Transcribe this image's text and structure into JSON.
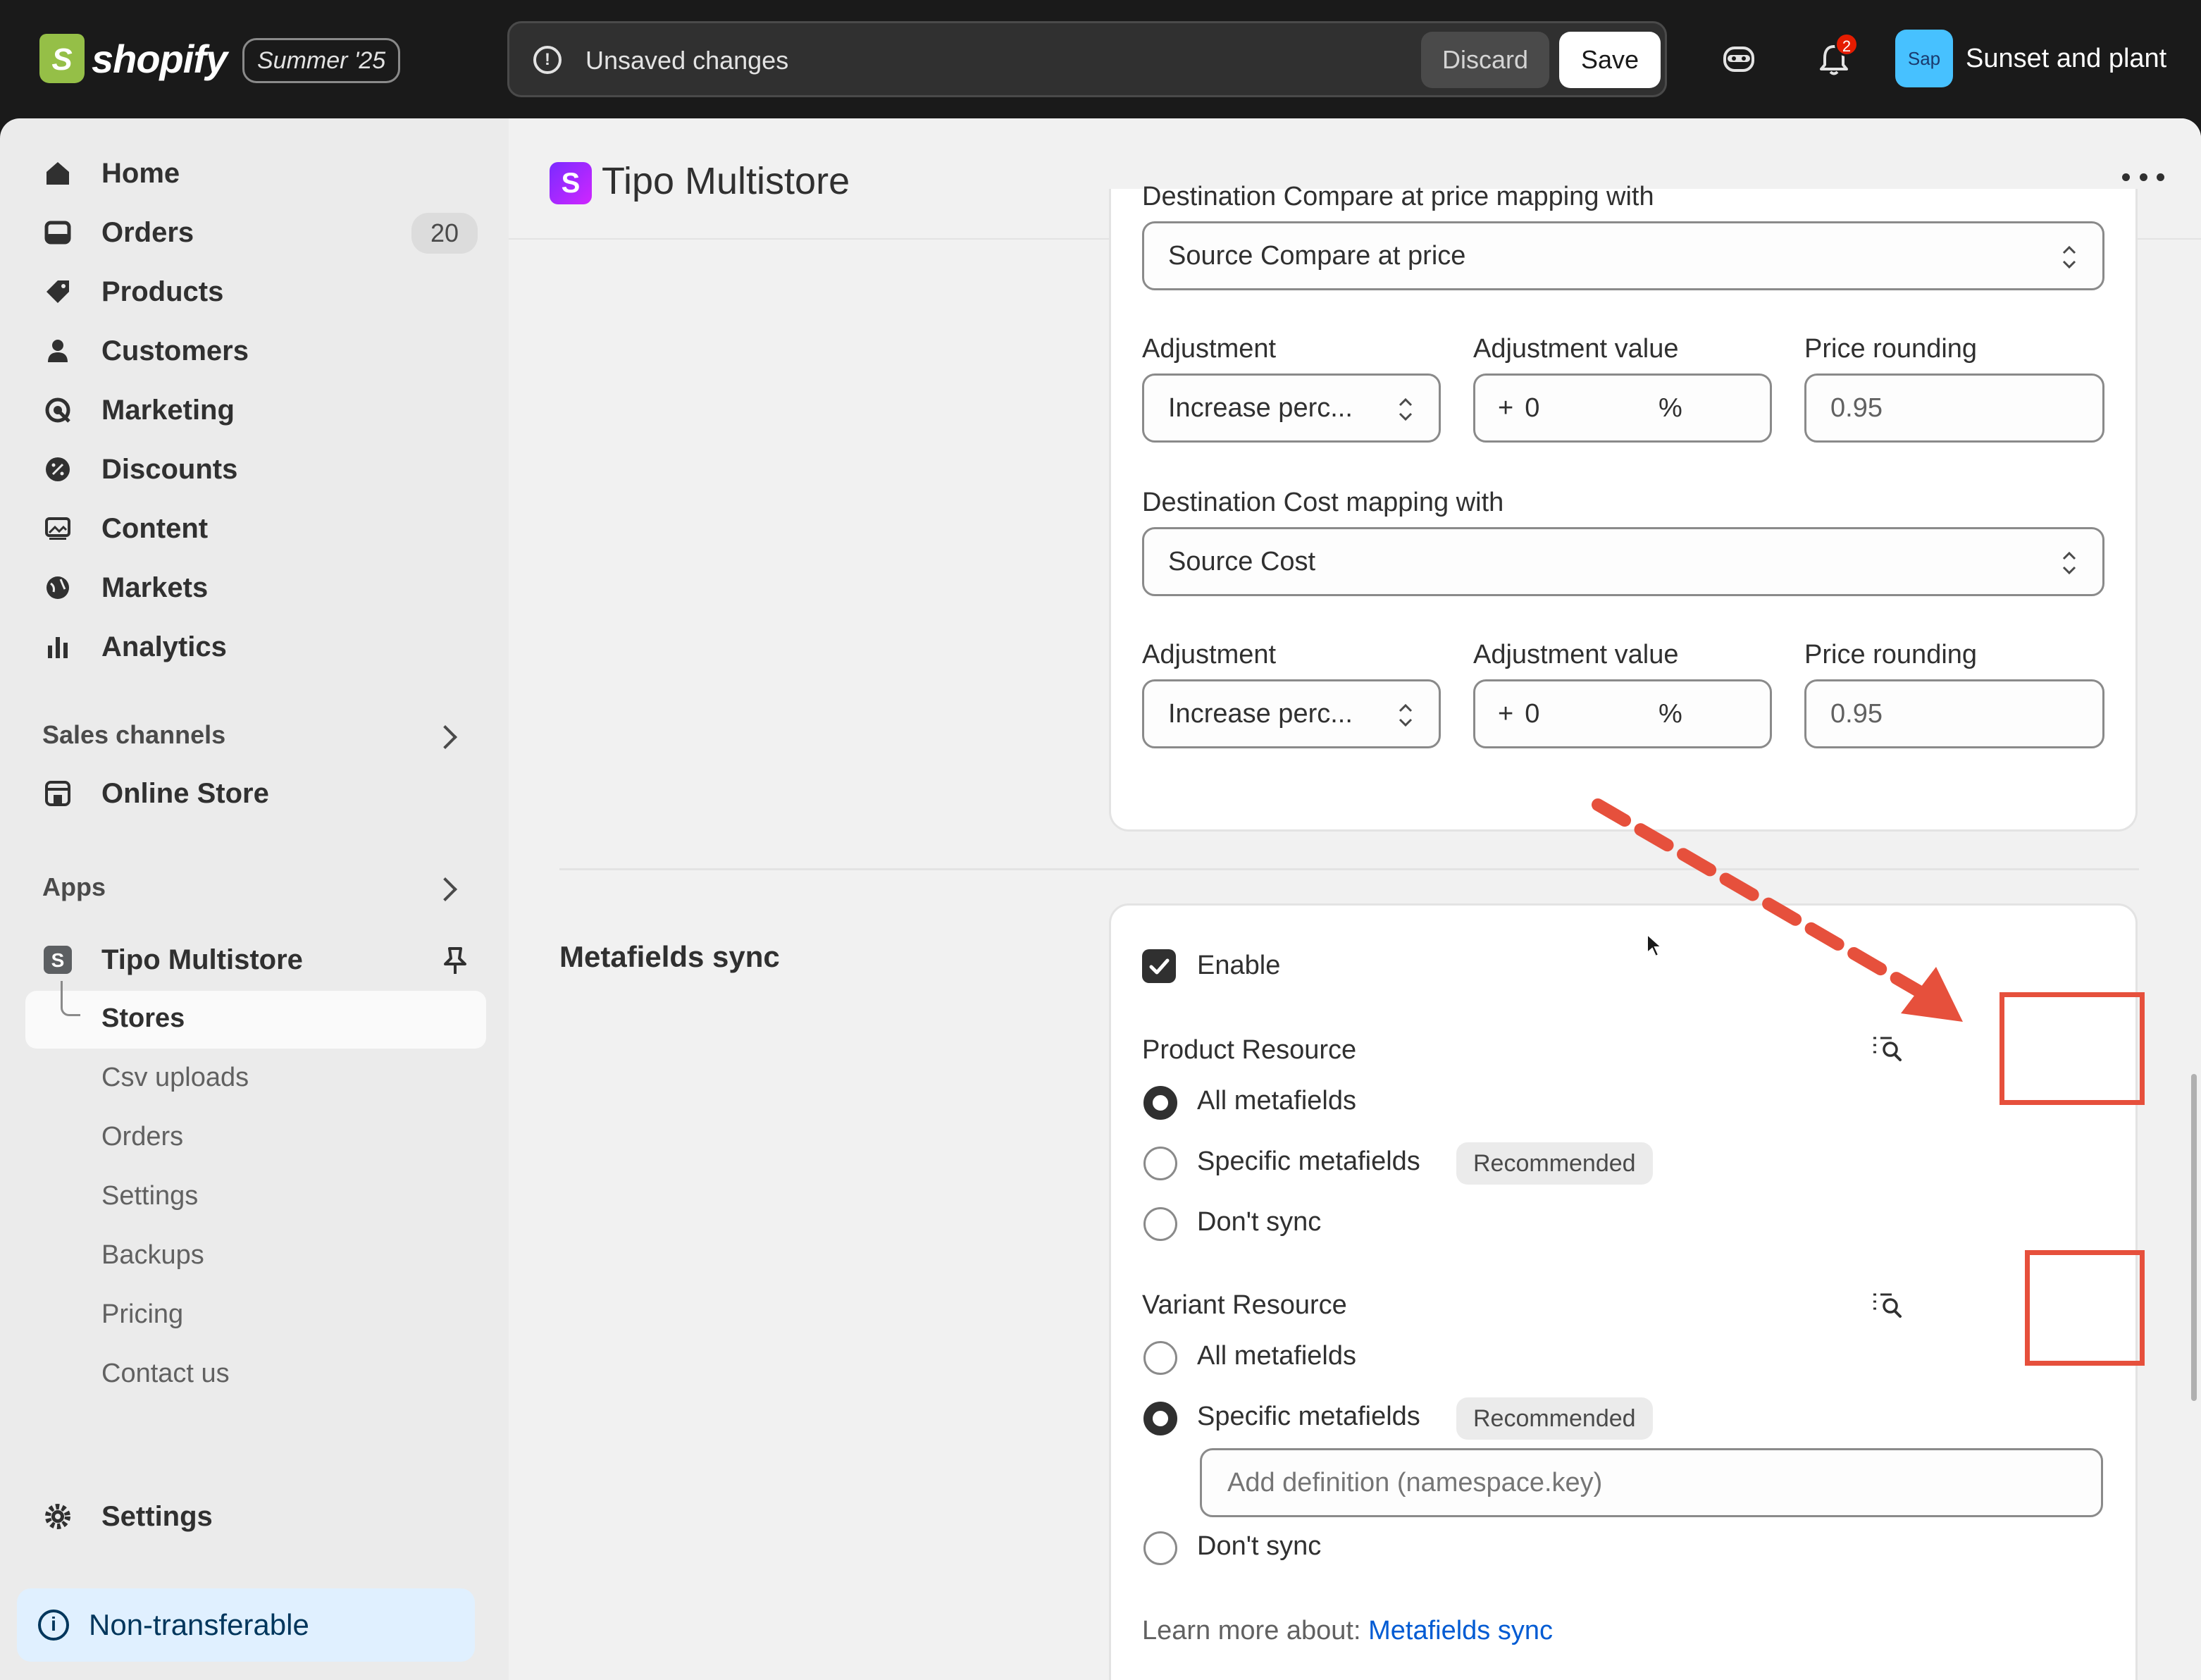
{
  "topbar": {
    "logo_text": "shopify",
    "edition": "Summer '25",
    "unsaved_text": "Unsaved changes",
    "discard_label": "Discard",
    "save_label": "Save",
    "notification_count": "2",
    "avatar_initials": "Sap",
    "store_name": "Sunset and plant"
  },
  "sidebar": {
    "nav": [
      {
        "label": "Home",
        "icon": "home-icon"
      },
      {
        "label": "Orders",
        "icon": "orders-icon",
        "badge": "20"
      },
      {
        "label": "Products",
        "icon": "tag-icon"
      },
      {
        "label": "Customers",
        "icon": "person-icon"
      },
      {
        "label": "Marketing",
        "icon": "target-icon"
      },
      {
        "label": "Discounts",
        "icon": "discount-icon"
      },
      {
        "label": "Content",
        "icon": "image-icon"
      },
      {
        "label": "Markets",
        "icon": "globe-icon"
      },
      {
        "label": "Analytics",
        "icon": "bar-chart-icon"
      }
    ],
    "sales_channels_label": "Sales channels",
    "online_store_label": "Online Store",
    "apps_label": "Apps",
    "app_name": "Tipo Multistore",
    "app_sub_items": [
      "Stores",
      "Csv uploads",
      "Orders",
      "Settings",
      "Backups",
      "Pricing",
      "Contact us"
    ],
    "settings_label": "Settings",
    "non_transferable_label": "Non-transferable"
  },
  "app": {
    "title": "Tipo Multistore"
  },
  "pricing_card": {
    "compare_label": "Destination Compare at price mapping with",
    "compare_value": "Source Compare at price",
    "rows": [
      {
        "adjustment_label": "Adjustment",
        "adjustment_value": "Increase perc...",
        "value_label": "Adjustment value",
        "sign": "+",
        "value": "0",
        "unit": "%",
        "rounding_label": "Price rounding",
        "rounding_placeholder": "0.95"
      },
      {
        "adjustment_label": "Adjustment",
        "adjustment_value": "Increase perc...",
        "value_label": "Adjustment value",
        "sign": "+",
        "value": "0",
        "unit": "%",
        "rounding_label": "Price rounding",
        "rounding_placeholder": "0.95"
      }
    ],
    "cost_label": "Destination Cost mapping with",
    "cost_value": "Source Cost"
  },
  "metafields": {
    "section_title": "Metafields sync",
    "enable_label": "Enable",
    "enable_checked": true,
    "product_resource_label": "Product Resource",
    "product_options": [
      "All metafields",
      "Specific metafields",
      "Don't sync"
    ],
    "product_selected": "All metafields",
    "recommended_tag": "Recommended",
    "variant_resource_label": "Variant Resource",
    "variant_options": [
      "All metafields",
      "Specific metafields",
      "Don't sync"
    ],
    "variant_selected": "Specific metafields",
    "definition_placeholder": "Add definition (namespace.key)",
    "learn_more_prefix": "Learn more about:",
    "learn_more_link": "Metafields sync"
  },
  "colors": {
    "annotation_red": "#e6503c",
    "link_blue": "#005bd3",
    "topbar_bg": "#1a1a1a"
  }
}
